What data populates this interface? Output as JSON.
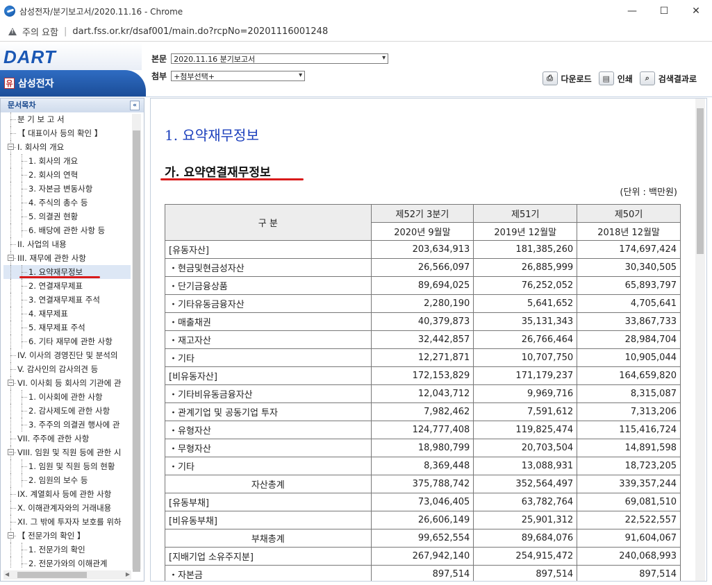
{
  "window": {
    "title": "삼성전자/분기보고서/2020.11.16 - Chrome",
    "controls": [
      "—",
      "☐",
      "✕"
    ]
  },
  "address": {
    "security_label": "주의 요함",
    "url": "dart.fss.or.kr/dsaf001/main.do?rcpNo=20201116001248"
  },
  "header": {
    "logo": "DART",
    "company_badge": "유",
    "company": "삼성전자",
    "doc_label": "본문",
    "doc_value": "2020.11.16  분기보고서",
    "attach_label": "첨부",
    "attach_value": "+첨부선택+",
    "tools": {
      "download": "다운로드",
      "print": "인쇄",
      "search_results": "검색결과로"
    }
  },
  "sidebar": {
    "title": "문서목차",
    "items": [
      {
        "label": "분 기 보 고 서",
        "level": "l0c",
        "toggle": ""
      },
      {
        "label": "【 대표이사 등의 확인 】",
        "level": "l0c",
        "toggle": ""
      },
      {
        "label": "I. 회사의 개요",
        "level": "l0",
        "toggle": "−"
      },
      {
        "label": "1. 회사의 개요",
        "level": "l1",
        "toggle": ""
      },
      {
        "label": "2. 회사의 연혁",
        "level": "l1",
        "toggle": ""
      },
      {
        "label": "3. 자본금 변동사항",
        "level": "l1",
        "toggle": ""
      },
      {
        "label": "4. 주식의 총수 등",
        "level": "l1",
        "toggle": ""
      },
      {
        "label": "5. 의결권 현황",
        "level": "l1",
        "toggle": ""
      },
      {
        "label": "6. 배당에 관한 사항 등",
        "level": "l1",
        "toggle": ""
      },
      {
        "label": "II. 사업의 내용",
        "level": "l0c",
        "toggle": ""
      },
      {
        "label": "III. 재무에 관한 사항",
        "level": "l0",
        "toggle": "−"
      },
      {
        "label": "1. 요약재무정보",
        "level": "l1",
        "toggle": "",
        "selected": true
      },
      {
        "label": "2. 연결재무제표",
        "level": "l1",
        "toggle": ""
      },
      {
        "label": "3. 연결재무제표 주석",
        "level": "l1",
        "toggle": ""
      },
      {
        "label": "4. 재무제표",
        "level": "l1",
        "toggle": ""
      },
      {
        "label": "5. 재무제표 주석",
        "level": "l1",
        "toggle": ""
      },
      {
        "label": "6. 기타 재무에 관한 사항",
        "level": "l1",
        "toggle": ""
      },
      {
        "label": "IV. 이사의 경영진단 및 분석의",
        "level": "l0c",
        "toggle": ""
      },
      {
        "label": "V. 감사인의 감사의견 등",
        "level": "l0c",
        "toggle": ""
      },
      {
        "label": "VI. 이사회 등 회사의 기관에 관",
        "level": "l0",
        "toggle": "−"
      },
      {
        "label": "1. 이사회에 관한 사항",
        "level": "l1",
        "toggle": ""
      },
      {
        "label": "2. 감사제도에 관한 사항",
        "level": "l1",
        "toggle": ""
      },
      {
        "label": "3. 주주의 의결권 행사에 관",
        "level": "l1",
        "toggle": ""
      },
      {
        "label": "VII. 주주에 관한 사항",
        "level": "l0c",
        "toggle": ""
      },
      {
        "label": "VIII. 임원 및 직원 등에 관한 시",
        "level": "l0",
        "toggle": "−"
      },
      {
        "label": "1. 임원 및 직원 등의 현황",
        "level": "l1",
        "toggle": ""
      },
      {
        "label": "2. 임원의 보수 등",
        "level": "l1",
        "toggle": ""
      },
      {
        "label": "IX. 계열회사 등에 관한 사항",
        "level": "l0c",
        "toggle": ""
      },
      {
        "label": "X. 이해관계자와의 거래내용",
        "level": "l0c",
        "toggle": ""
      },
      {
        "label": "XI. 그 밖에 투자자 보호를 위하",
        "level": "l0c",
        "toggle": ""
      },
      {
        "label": "【 전문가의 확인 】",
        "level": "l0",
        "toggle": "−"
      },
      {
        "label": "1. 전문가의 확인",
        "level": "l1",
        "toggle": ""
      },
      {
        "label": "2. 전문가와의 이해관계",
        "level": "l1",
        "toggle": ""
      }
    ]
  },
  "content": {
    "title": "1. 요약재무정보",
    "subtitle": "가. 요약연결재무정보",
    "unit": "(단위 : 백만원)",
    "table": {
      "header_row1": [
        "구 분",
        "제52기 3분기",
        "제51기",
        "제50기"
      ],
      "header_row2": [
        "2020년 9월말",
        "2019년 12월말",
        "2018년 12월말"
      ],
      "rows": [
        {
          "label": "[유동자산]",
          "type": "lbl",
          "values": [
            "203,634,913",
            "181,385,260",
            "174,697,424"
          ]
        },
        {
          "label": "・현금및현금성자산",
          "type": "lbl",
          "values": [
            "26,566,097",
            "26,885,999",
            "30,340,505"
          ]
        },
        {
          "label": "・단기금융상품",
          "type": "lbl",
          "values": [
            "89,694,025",
            "76,252,052",
            "65,893,797"
          ]
        },
        {
          "label": "・기타유동금융자산",
          "type": "lbl",
          "values": [
            "2,280,190",
            "5,641,652",
            "4,705,641"
          ]
        },
        {
          "label": "・매출채권",
          "type": "lbl",
          "values": [
            "40,379,873",
            "35,131,343",
            "33,867,733"
          ]
        },
        {
          "label": "・재고자산",
          "type": "lbl",
          "values": [
            "32,442,857",
            "26,766,464",
            "28,984,704"
          ]
        },
        {
          "label": "・기타",
          "type": "lbl",
          "values": [
            "12,271,871",
            "10,707,750",
            "10,905,044"
          ]
        },
        {
          "label": "[비유동자산]",
          "type": "lbl",
          "values": [
            "172,153,829",
            "171,179,237",
            "164,659,820"
          ]
        },
        {
          "label": "・기타비유동금융자산",
          "type": "lbl",
          "values": [
            "12,043,712",
            "9,969,716",
            "8,315,087"
          ]
        },
        {
          "label": "・관계기업 및 공동기업 투자",
          "type": "lbl",
          "values": [
            "7,982,462",
            "7,591,612",
            "7,313,206"
          ]
        },
        {
          "label": "・유형자산",
          "type": "lbl",
          "values": [
            "124,777,408",
            "119,825,474",
            "115,416,724"
          ]
        },
        {
          "label": "・무형자산",
          "type": "lbl",
          "values": [
            "18,980,799",
            "20,703,504",
            "14,891,598"
          ]
        },
        {
          "label": "・기타",
          "type": "lbl",
          "values": [
            "8,369,448",
            "13,088,931",
            "18,723,205"
          ]
        },
        {
          "label": "자산총계",
          "type": "total",
          "values": [
            "375,788,742",
            "352,564,497",
            "339,357,244"
          ]
        },
        {
          "label": "[유동부채]",
          "type": "lbl",
          "values": [
            "73,046,405",
            "63,782,764",
            "69,081,510"
          ]
        },
        {
          "label": "[비유동부채]",
          "type": "lbl",
          "values": [
            "26,606,149",
            "25,901,312",
            "22,522,557"
          ]
        },
        {
          "label": "부채총계",
          "type": "total",
          "values": [
            "99,652,554",
            "89,684,076",
            "91,604,067"
          ]
        },
        {
          "label": "[지배기업 소유주지분]",
          "type": "lbl",
          "values": [
            "267,942,140",
            "254,915,472",
            "240,068,993"
          ]
        },
        {
          "label": "・자본금",
          "type": "lbl",
          "values": [
            "897,514",
            "897,514",
            "897,514"
          ]
        }
      ]
    }
  }
}
